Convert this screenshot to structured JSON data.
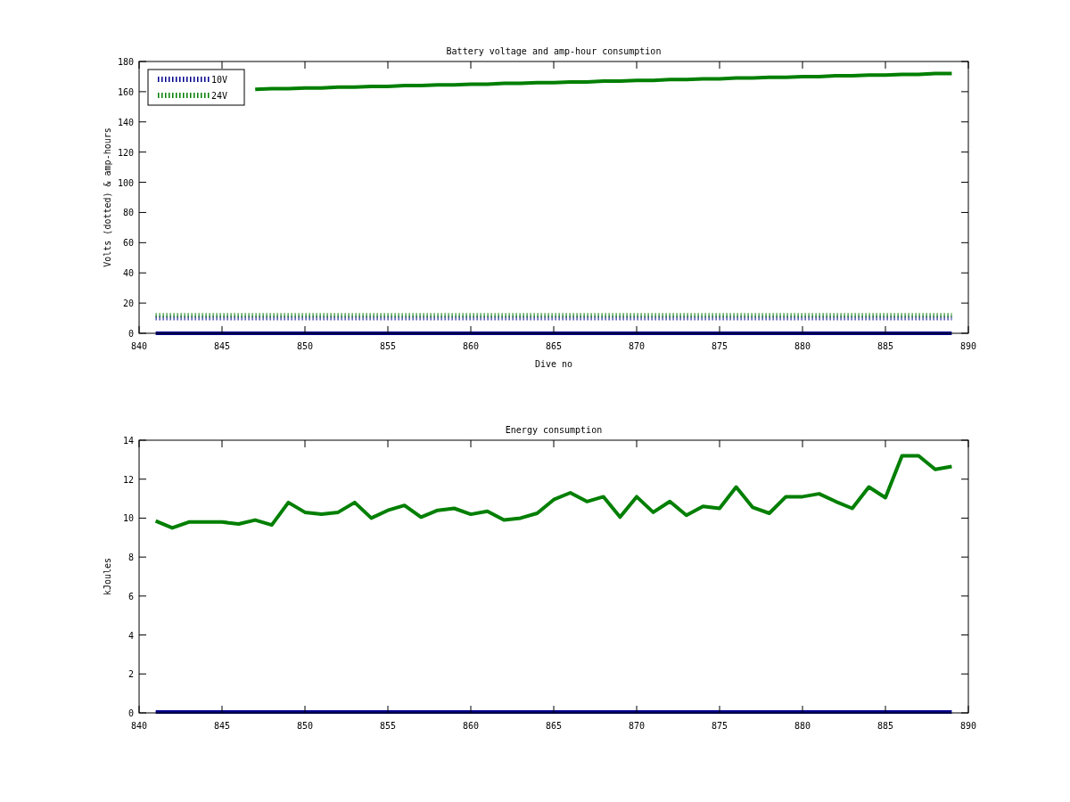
{
  "charts": [
    {
      "chart_data": {
        "type": "line",
        "title": "Battery voltage and amp-hour consumption",
        "xlabel": "Dive no",
        "ylabel": "Volts (dotted) & amp-hours",
        "x": [
          841,
          842,
          843,
          844,
          845,
          846,
          847,
          848,
          849,
          850,
          851,
          852,
          853,
          854,
          855,
          856,
          857,
          858,
          859,
          860,
          861,
          862,
          863,
          864,
          865,
          866,
          867,
          868,
          869,
          870,
          871,
          872,
          873,
          874,
          875,
          876,
          877,
          878,
          879,
          880,
          881,
          882,
          883,
          884,
          885,
          886,
          887,
          888,
          889
        ],
        "xlim": [
          840,
          890
        ],
        "ylim": [
          0,
          180
        ],
        "xticks": [
          840,
          845,
          850,
          855,
          860,
          865,
          870,
          875,
          880,
          885,
          890
        ],
        "yticks": [
          0,
          20,
          40,
          60,
          80,
          100,
          120,
          140,
          160,
          180
        ],
        "legend": "upper left",
        "series": [
          {
            "name": "10V",
            "color": "#00008b",
            "line_style": "dotted",
            "values": [
              10,
              10,
              10,
              10,
              10,
              10,
              10,
              10,
              10,
              10,
              10,
              10,
              10,
              10,
              10,
              10,
              10,
              10,
              10,
              10,
              10,
              10,
              10,
              10,
              10,
              10,
              10,
              10,
              10,
              10,
              10,
              10,
              10,
              10,
              10,
              10,
              10,
              10,
              10,
              10,
              10,
              10,
              10,
              10,
              10,
              10,
              10,
              10,
              10
            ]
          },
          {
            "name": "24V",
            "color": "#007f00",
            "line_style": "dotted",
            "values": [
              12,
              12,
              12,
              12,
              12,
              12,
              12,
              12,
              12,
              12,
              12,
              12,
              12,
              12,
              12,
              12,
              12,
              12,
              12,
              12,
              12,
              12,
              12,
              12,
              12,
              12,
              12,
              12,
              12,
              12,
              12,
              12,
              12,
              12,
              12,
              12,
              12,
              12,
              12,
              12,
              12,
              12,
              12,
              12,
              12,
              12,
              12,
              12,
              12
            ]
          },
          {
            "color": "#00008b",
            "line_style": "solid",
            "values": [
              0,
              0,
              0,
              0,
              0,
              0,
              0,
              0,
              0,
              0,
              0,
              0,
              0,
              0,
              0,
              0,
              0,
              0,
              0,
              0,
              0,
              0,
              0,
              0,
              0,
              0,
              0,
              0,
              0,
              0,
              0,
              0,
              0,
              0,
              0,
              0,
              0,
              0,
              0,
              0,
              0,
              0,
              0,
              0,
              0,
              0,
              0,
              0,
              0
            ]
          },
          {
            "color": "#007f00",
            "line_style": "solid",
            "values": [
              null,
              null,
              null,
              null,
              null,
              null,
              161.5,
              162,
              162,
              162.5,
              162.5,
              163,
              163,
              163.5,
              163.5,
              164,
              164,
              164.5,
              164.5,
              165,
              165,
              165.5,
              165.5,
              166,
              166,
              166.5,
              166.5,
              167,
              167,
              167.5,
              167.5,
              168,
              168,
              168.5,
              168.5,
              169,
              169,
              169.5,
              169.5,
              170,
              170,
              170.5,
              170.5,
              171,
              171,
              171.5,
              171.5,
              172,
              172
            ]
          }
        ]
      }
    },
    {
      "chart_data": {
        "type": "line",
        "title": "Energy consumption",
        "ylabel": "kJoules",
        "x": [
          841,
          842,
          843,
          844,
          845,
          846,
          847,
          848,
          849,
          850,
          851,
          852,
          853,
          854,
          855,
          856,
          857,
          858,
          859,
          860,
          861,
          862,
          863,
          864,
          865,
          866,
          867,
          868,
          869,
          870,
          871,
          872,
          873,
          874,
          875,
          876,
          877,
          878,
          879,
          880,
          881,
          882,
          883,
          884,
          885,
          886,
          887,
          888,
          889
        ],
        "xlim": [
          840,
          890
        ],
        "ylim": [
          0,
          14
        ],
        "xticks": [
          840,
          845,
          850,
          855,
          860,
          865,
          870,
          875,
          880,
          885,
          890
        ],
        "yticks": [
          0,
          2,
          4,
          6,
          8,
          10,
          12,
          14
        ],
        "series": [
          {
            "color": "#00008b",
            "line_style": "solid",
            "values": [
              0.05,
              0.05,
              0.05,
              0.05,
              0.05,
              0.05,
              0.05,
              0.05,
              0.05,
              0.05,
              0.05,
              0.05,
              0.05,
              0.05,
              0.05,
              0.05,
              0.05,
              0.05,
              0.05,
              0.05,
              0.05,
              0.05,
              0.05,
              0.05,
              0.05,
              0.05,
              0.05,
              0.05,
              0.05,
              0.05,
              0.05,
              0.05,
              0.05,
              0.05,
              0.05,
              0.05,
              0.05,
              0.05,
              0.05,
              0.05,
              0.05,
              0.05,
              0.05,
              0.05,
              0.05,
              0.05,
              0.05,
              0.05,
              0.05
            ]
          },
          {
            "color": "#007f00",
            "line_style": "solid",
            "values": [
              9.85,
              9.5,
              9.8,
              9.8,
              9.8,
              9.7,
              9.9,
              9.65,
              10.8,
              10.3,
              10.2,
              10.3,
              10.8,
              10.0,
              10.4,
              10.65,
              10.05,
              10.4,
              10.5,
              10.2,
              10.35,
              9.9,
              10.0,
              10.25,
              10.95,
              11.3,
              10.85,
              11.1,
              10.05,
              11.1,
              10.3,
              10.85,
              10.15,
              10.6,
              10.5,
              11.6,
              10.55,
              10.25,
              11.1,
              11.1,
              11.25,
              10.85,
              10.5,
              11.6,
              11.05,
              13.2,
              13.2,
              12.5,
              12.65
            ]
          }
        ]
      }
    }
  ]
}
